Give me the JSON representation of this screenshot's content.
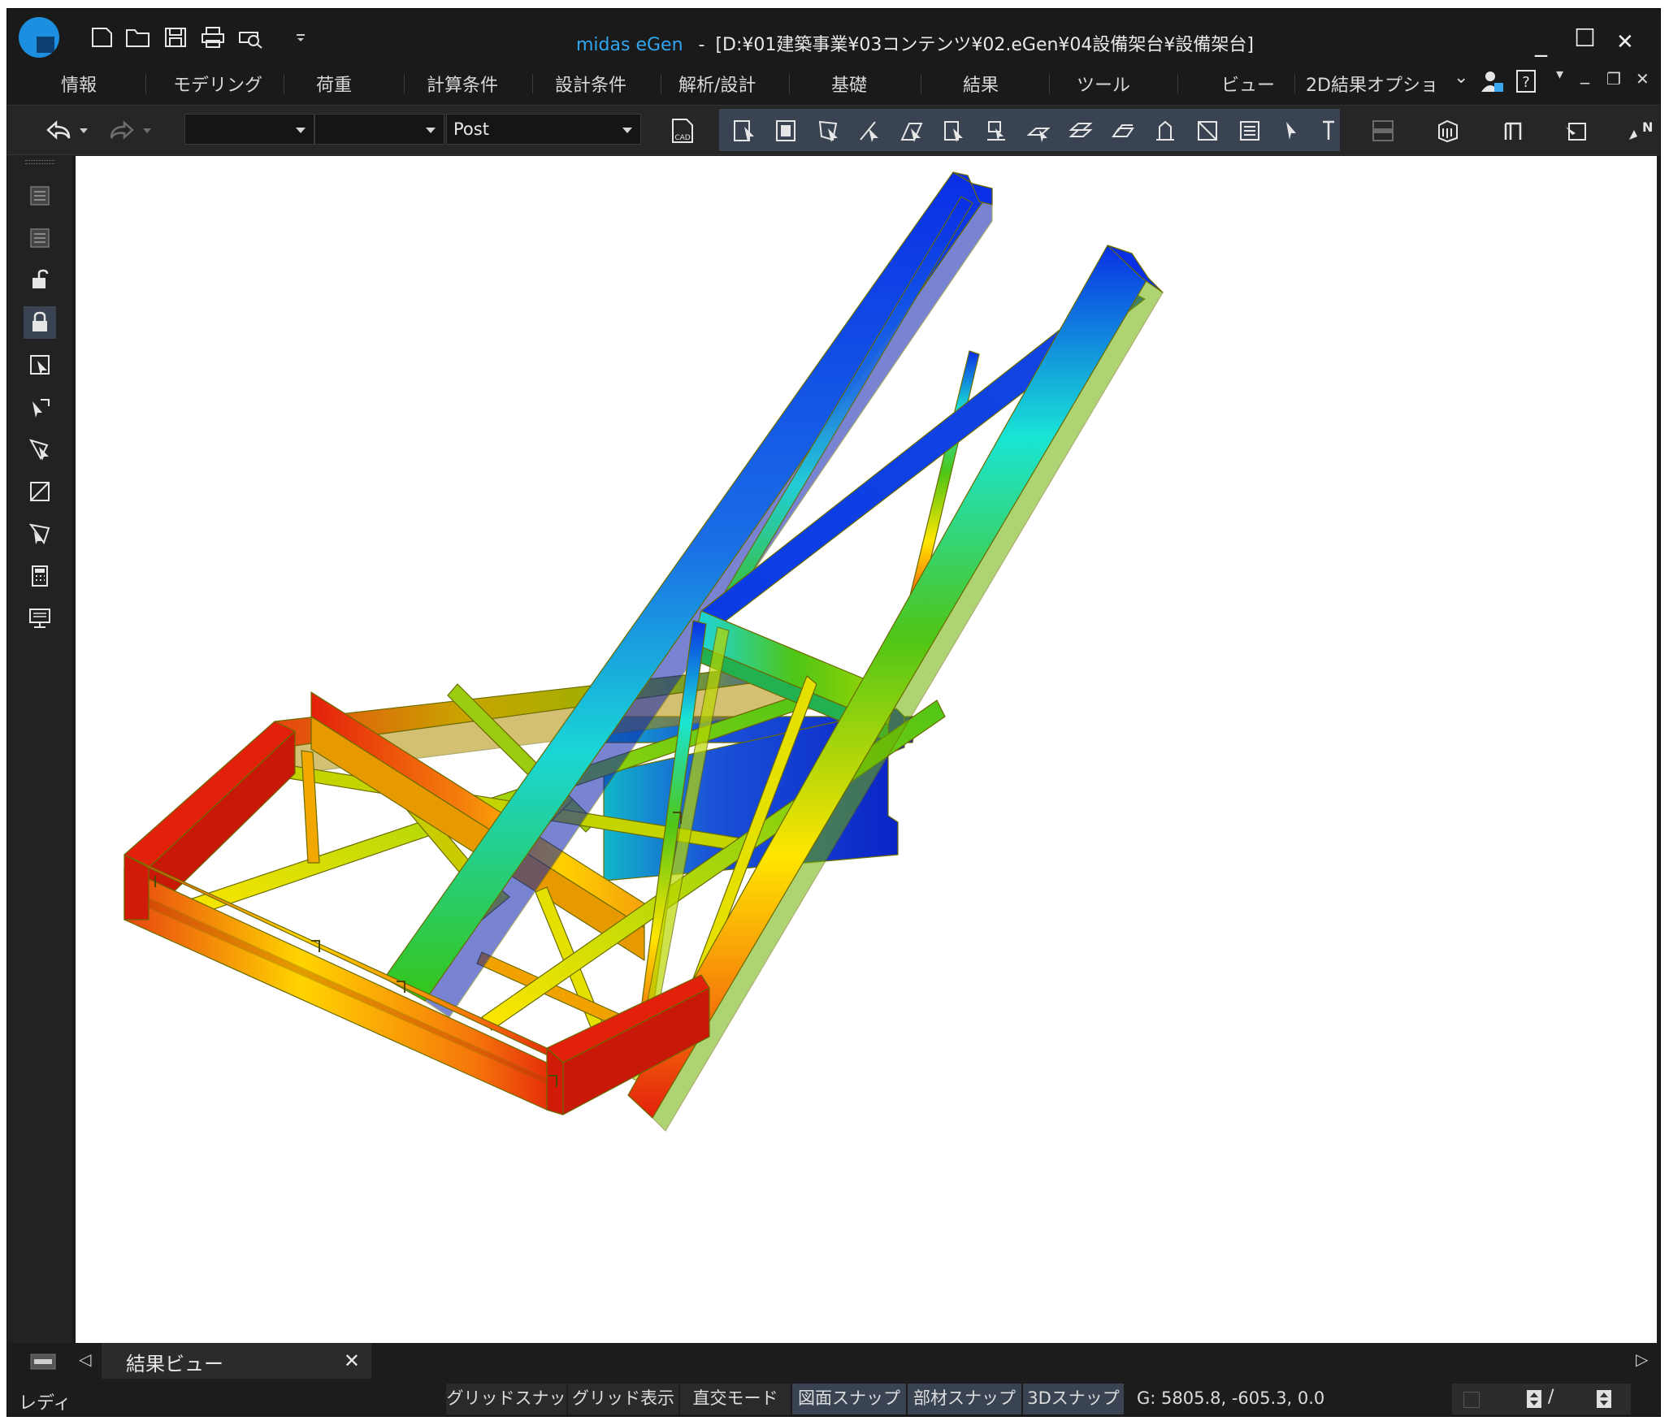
{
  "window": {
    "app_name": "midas eGen",
    "separator": "-",
    "path": "[D:¥01建築事業¥03コンテンツ¥02.eGen¥04設備架台¥設備架台]",
    "minimize": "_",
    "maximize": "☐",
    "close": "✕"
  },
  "quick_access": [
    "new-icon",
    "open-icon",
    "save-icon",
    "print-icon",
    "print-preview-icon",
    "customize-icon"
  ],
  "menu": {
    "items": [
      "情報",
      "モデリング",
      "荷重",
      "計算条件",
      "設計条件",
      "解析/設計",
      "基礎",
      "結果",
      "ツール",
      "ビュー",
      "2D結果オプショ"
    ],
    "right_controls": {
      "chevron": "⌄",
      "help": "?",
      "min": "_",
      "restore": "❐",
      "close": "✕"
    }
  },
  "toolbar": {
    "combo1": "",
    "combo2": "",
    "combo3": "Post",
    "cad_label": "CAD"
  },
  "viewport": {
    "colors": {
      "red": "#e3200b",
      "orange": "#f57f0b",
      "yellow": "#ffeb00",
      "green": "#4fc516",
      "cyan": "#19e5e5",
      "blue": "#0a2fe6"
    }
  },
  "tabs": {
    "prev": "◁",
    "label": "結果ビュー",
    "close": "✕",
    "next": "▷"
  },
  "status": {
    "ready": "レディ",
    "buttons": [
      "グリッドスナップ",
      "グリッド表示",
      "直交モード",
      "図面スナップ",
      "部材スナップ",
      "3Dスナップ"
    ],
    "coord": "G: 5805.8, -605.3, 0.0",
    "slash": "/"
  }
}
